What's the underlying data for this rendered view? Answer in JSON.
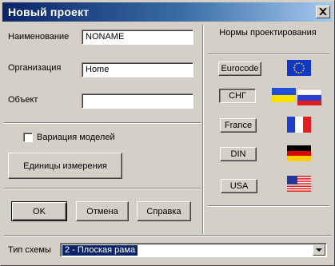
{
  "window": {
    "title": "Новый проект"
  },
  "form": {
    "name_label": "Наименование",
    "name_value": "NONAME",
    "org_label": "Организация",
    "org_value": "Home",
    "object_label": "Объект",
    "object_value": "",
    "variation_label": "Вариация моделей",
    "variation_checked": false,
    "units_button": "Единицы измерения"
  },
  "norms": {
    "title": "Нормы проектирования",
    "items": [
      {
        "label": "Eurocode",
        "flag": "eu-flag-icon",
        "selected": false
      },
      {
        "label": "СНГ",
        "flag": "ukraine-russia-flags-icon",
        "selected": true
      },
      {
        "label": "France",
        "flag": "france-flag-icon",
        "selected": false
      },
      {
        "label": "DIN",
        "flag": "germany-flag-icon",
        "selected": false
      },
      {
        "label": "USA",
        "flag": "usa-flag-icon",
        "selected": false
      }
    ]
  },
  "actions": {
    "ok": "OK",
    "cancel": "Отмена",
    "help": "Справка"
  },
  "scheme": {
    "label": "Тип схемы",
    "value": "2 - Плоская рама"
  },
  "colors": {
    "face": "#d4d0c8",
    "title_start": "#0a246a",
    "title_end": "#a6caf0",
    "selection": "#0a246a"
  }
}
